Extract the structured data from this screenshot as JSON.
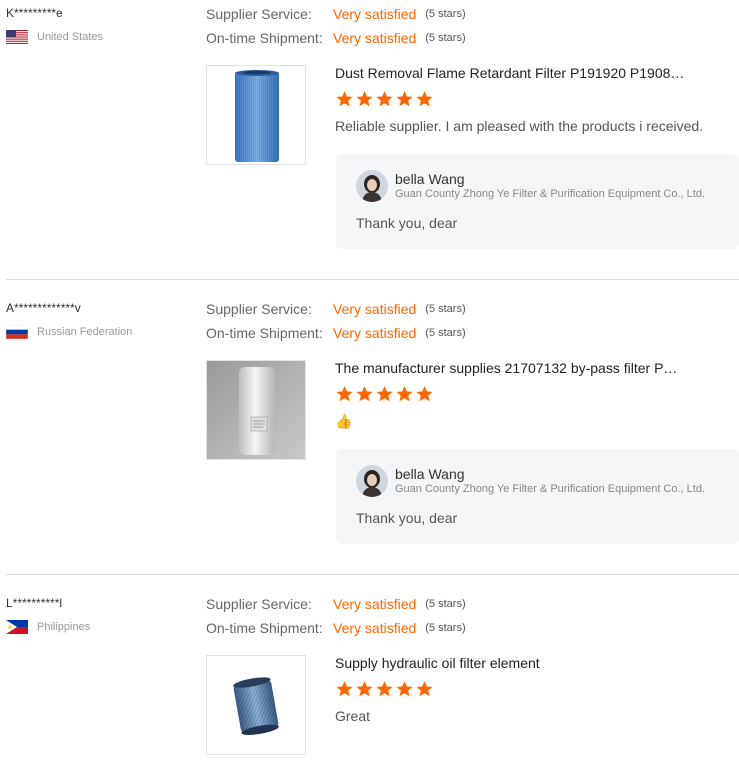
{
  "labels": {
    "supplier_service": "Supplier Service:",
    "ontime_shipment": "On-time Shipment:"
  },
  "reviews": [
    {
      "buyer": "K*********e",
      "country": "United States",
      "flag_icon": "us-flag-icon",
      "supplier_service": {
        "value": "Very satisfied",
        "stars": "(5 stars)"
      },
      "ontime_shipment": {
        "value": "Very satisfied",
        "stars": "(5 stars)"
      },
      "product_title": "Dust Removal Flame Retardant Filter P191920 P1908…",
      "rating": 5,
      "comment": "Reliable supplier. I am pleased with the products i received.",
      "reply": {
        "name": "bella Wang",
        "company": "Guan County Zhong Ye Filter & Purification Equipment Co., Ltd.",
        "text": "Thank you, dear"
      }
    },
    {
      "buyer": "A*************v",
      "country": "Russian Federation",
      "flag_icon": "russia-flag-icon",
      "supplier_service": {
        "value": "Very satisfied",
        "stars": "(5 stars)"
      },
      "ontime_shipment": {
        "value": "Very satisfied",
        "stars": "(5 stars)"
      },
      "product_title": "The manufacturer supplies 21707132 by-pass filter P…",
      "rating": 5,
      "comment": "👍",
      "reply": {
        "name": "bella Wang",
        "company": "Guan County Zhong Ye Filter & Purification Equipment Co., Ltd.",
        "text": "Thank you, dear"
      }
    },
    {
      "buyer": "L**********l",
      "country": "Philippines",
      "flag_icon": "philippines-flag-icon",
      "supplier_service": {
        "value": "Very satisfied",
        "stars": "(5 stars)"
      },
      "ontime_shipment": {
        "value": "Very satisfied",
        "stars": "(5 stars)"
      },
      "product_title": "Supply hydraulic oil filter element",
      "rating": 5,
      "comment": "Great"
    }
  ],
  "colors": {
    "accent": "#ff6600",
    "reply_bg": "#f5f6f8"
  }
}
